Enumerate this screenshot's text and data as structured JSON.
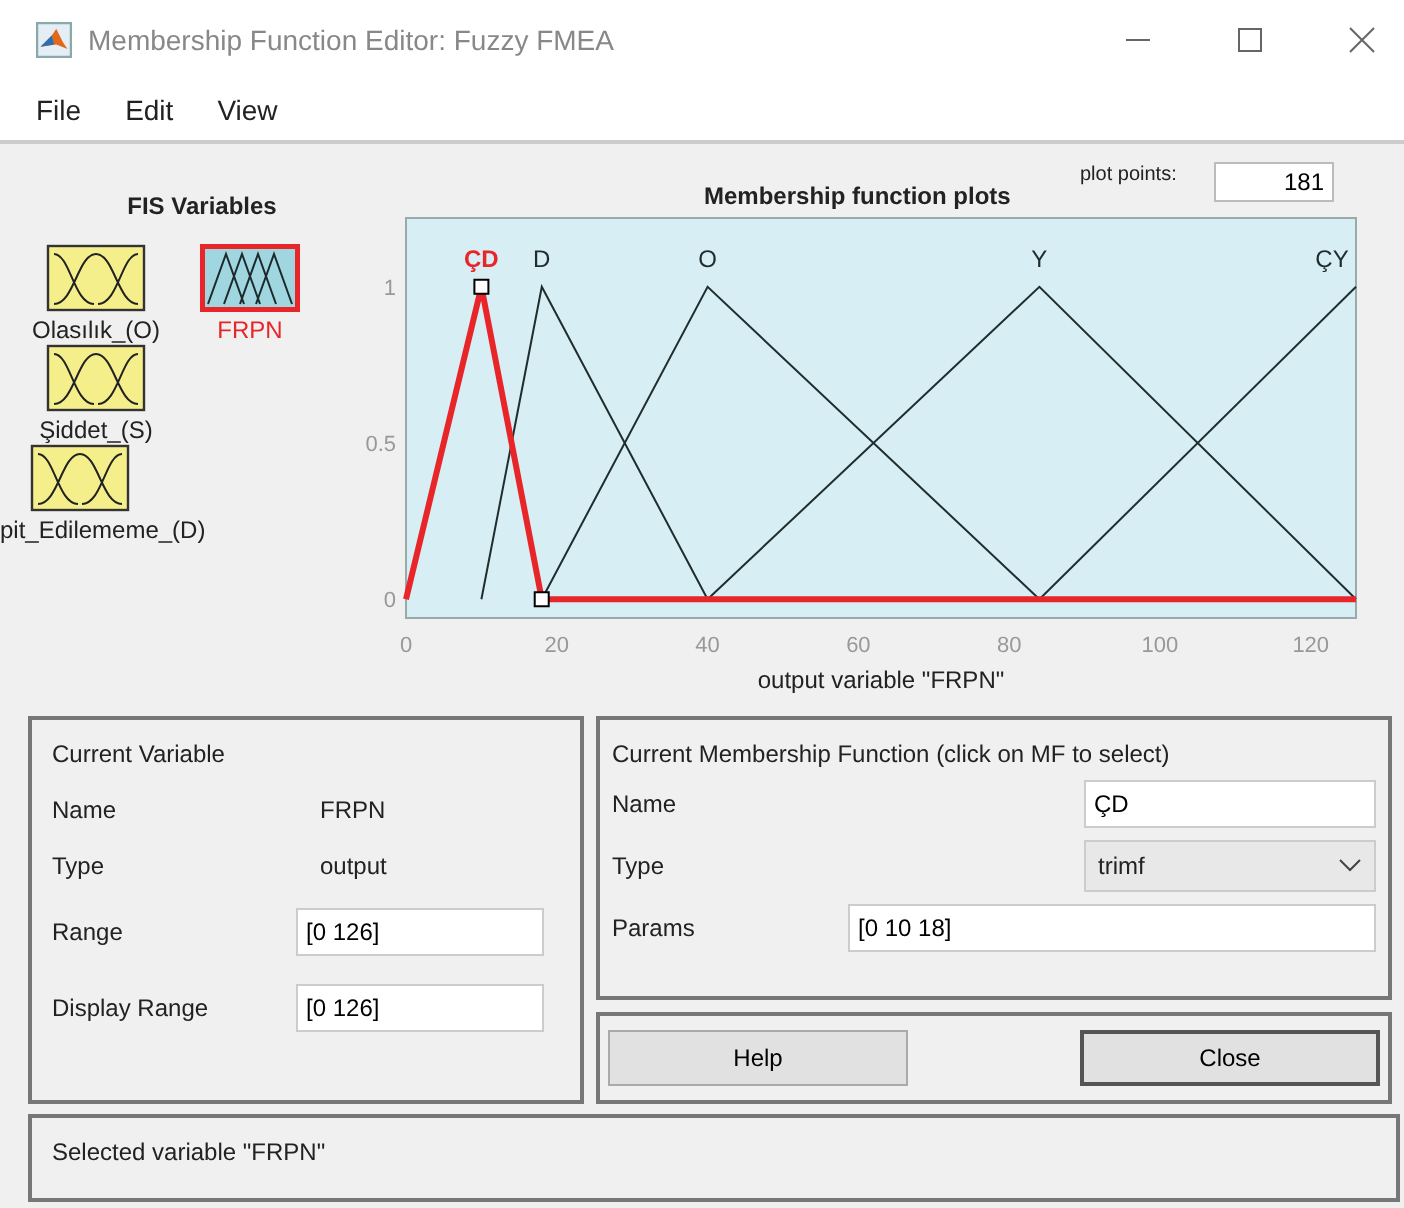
{
  "window": {
    "title": "Membership Function Editor: Fuzzy FMEA"
  },
  "menu": [
    "File",
    "Edit",
    "View"
  ],
  "fis_variables": {
    "title": "FIS Variables",
    "items": [
      {
        "name": "Olasılık_(O)",
        "kind": "input",
        "selected": false
      },
      {
        "name": "FRPN",
        "kind": "output",
        "selected": true
      },
      {
        "name": "Şiddet_(S)",
        "kind": "input",
        "selected": false
      },
      {
        "name": "pit_Edilememe_(D)",
        "kind": "input",
        "selected": false
      }
    ]
  },
  "plot": {
    "plot_points_label": "plot points:",
    "plot_points": "181",
    "chart_data": {
      "type": "line",
      "title": "Membership function plots",
      "xlabel": "output variable \"FRPN\"",
      "x": [
        0,
        10,
        18,
        40,
        84,
        126
      ],
      "xlim": [
        0,
        126
      ],
      "ylim": [
        -0.06,
        1.22
      ],
      "xticks": [
        0,
        20,
        40,
        60,
        80,
        100,
        120
      ],
      "yticks": [
        0,
        0.5,
        1
      ],
      "series": [
        {
          "name": "ÇD",
          "color": "#e8262a",
          "values": [
            0,
            1,
            0,
            0,
            0,
            0
          ]
        },
        {
          "name": "D",
          "color": "#1f2d2d",
          "values": [
            null,
            0,
            1,
            0,
            null,
            null
          ]
        },
        {
          "name": "O",
          "color": "#1f2d2d",
          "values": [
            null,
            null,
            0,
            1,
            0,
            null
          ]
        },
        {
          "name": "Y",
          "color": "#1f2d2d",
          "values": [
            null,
            null,
            null,
            0,
            1,
            0
          ]
        },
        {
          "name": "ÇY",
          "color": "#1f2d2d",
          "values": [
            null,
            null,
            null,
            null,
            0,
            1
          ]
        }
      ]
    },
    "curve_states": [
      {
        "selected": true
      },
      {
        "selected": false
      },
      {
        "selected": false
      },
      {
        "selected": false
      },
      {
        "selected": false
      }
    ]
  },
  "current_variable": {
    "title": "Current Variable",
    "name_label": "Name",
    "name": "FRPN",
    "type_label": "Type",
    "type": "output",
    "range_label": "Range",
    "range": "[0 126]",
    "display_range_label": "Display Range",
    "display_range": "[0 126]"
  },
  "current_mf": {
    "title": "Current Membership Function (click on MF to select)",
    "name_label": "Name",
    "name": "ÇD",
    "type_label": "Type",
    "type": "trimf",
    "params_label": "Params",
    "params": "[0 10 18]"
  },
  "buttons": [
    "Help",
    "Close"
  ],
  "status": "Selected variable \"FRPN\""
}
